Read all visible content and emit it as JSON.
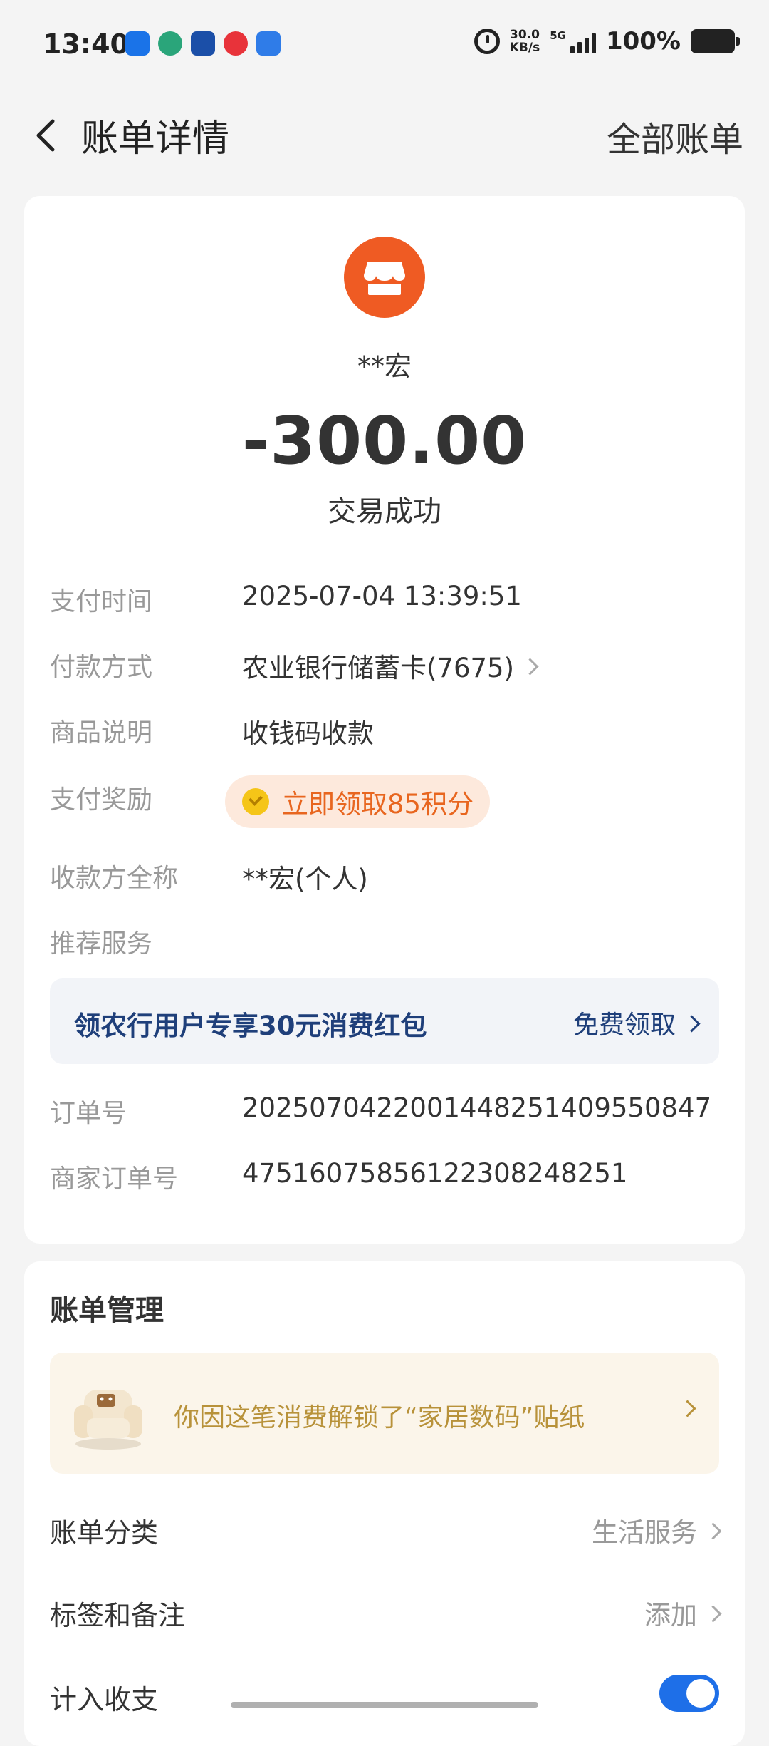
{
  "status_bar": {
    "time": "13:40",
    "net_speed_value": "30.0",
    "net_speed_unit": "KB/s",
    "network": "5G",
    "battery": "100%",
    "app_icon_colors": [
      "#1a73e8",
      "#2aa57a",
      "#1b4fa8",
      "#e8333a",
      "#2f7ce8"
    ]
  },
  "nav": {
    "title": "账单详情",
    "right_action": "全部账单"
  },
  "transaction": {
    "merchant_name": "**宏",
    "amount": "-300.00",
    "status": "交易成功",
    "rows": {
      "pay_time_label": "支付时间",
      "pay_time_value": "2025-07-04 13:39:51",
      "pay_method_label": "付款方式",
      "pay_method_value": "农业银行储蓄卡(7675)",
      "desc_label": "商品说明",
      "desc_value": "收钱码收款",
      "reward_label": "支付奖励",
      "reward_value": "立即领取85积分",
      "payee_label": "收款方全称",
      "payee_value": "**宏(个人)",
      "recommend_label": "推荐服务",
      "order_label": "订单号",
      "order_value": "2025070422001448251409550847",
      "merchant_order_label": "商家订单号",
      "merchant_order_value": "47516075856122308248251"
    },
    "promo": {
      "text": "领农行用户专享30元消费红包",
      "action": "免费领取"
    }
  },
  "management": {
    "title": "账单管理",
    "sticker_text": "你因这笔消费解锁了“家居数码”贴纸",
    "category_label": "账单分类",
    "category_value": "生活服务",
    "tags_label": "标签和备注",
    "tags_value": "添加",
    "include_label": "计入收支",
    "include_on": true
  },
  "colors": {
    "accent_orange": "#ef5b23",
    "promo_blue": "#1f3f7a",
    "toggle_blue": "#1e6fe8"
  }
}
